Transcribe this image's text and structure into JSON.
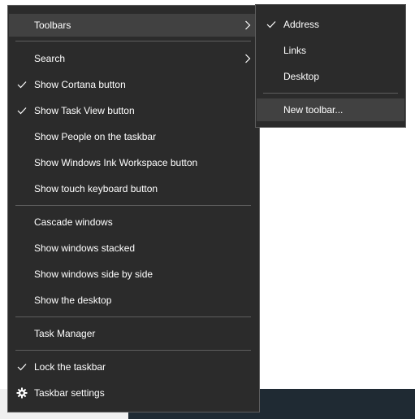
{
  "main_menu": {
    "toolbars": "Toolbars",
    "search": "Search",
    "show_cortana": "Show Cortana button",
    "show_task_view": "Show Task View button",
    "show_people": "Show People on the taskbar",
    "show_ink": "Show Windows Ink Workspace button",
    "show_touch_keyboard": "Show touch keyboard button",
    "cascade": "Cascade windows",
    "stacked": "Show windows stacked",
    "side_by_side": "Show windows side by side",
    "show_desktop": "Show the desktop",
    "task_manager": "Task Manager",
    "lock_taskbar": "Lock the taskbar",
    "taskbar_settings": "Taskbar settings"
  },
  "sub_menu": {
    "address": "Address",
    "links": "Links",
    "desktop": "Desktop",
    "new_toolbar": "New toolbar..."
  },
  "colors": {
    "menu_bg": "#2b2b2b",
    "hover_bg": "#414141",
    "separator": "#5e5e5e",
    "text": "#ffffff"
  }
}
